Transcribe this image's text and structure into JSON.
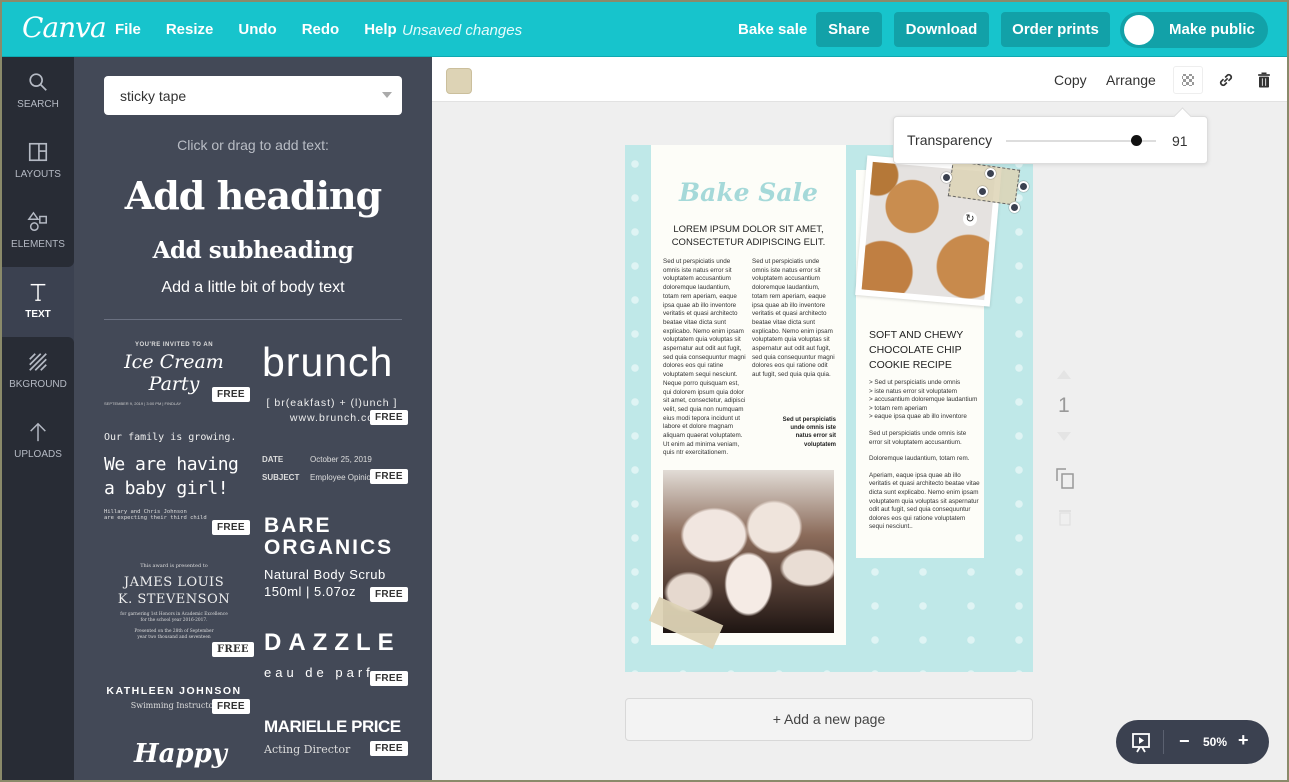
{
  "app": {
    "logo": "Canva",
    "menu": [
      "File",
      "Resize",
      "Undo",
      "Redo",
      "Help"
    ],
    "status": "Unsaved changes",
    "design_title": "Bake sale",
    "share": "Share",
    "download": "Download",
    "order_prints": "Order prints",
    "make_public": "Make public",
    "make_public_on": false,
    "accent": "#17c4cc"
  },
  "rail": [
    {
      "label": "SEARCH",
      "icon": "search-icon"
    },
    {
      "label": "LAYOUTS",
      "icon": "layouts-icon"
    },
    {
      "label": "ELEMENTS",
      "icon": "elements-icon"
    },
    {
      "label": "TEXT",
      "icon": "text-icon",
      "active": true
    },
    {
      "label": "BKGROUND",
      "icon": "background-icon"
    },
    {
      "label": "UPLOADS",
      "icon": "upload-icon"
    }
  ],
  "panel": {
    "search_value": "sticky tape",
    "hint": "Click or drag to add text:",
    "add_heading": "Add heading",
    "add_subheading": "Add subheading",
    "add_body": "Add a little bit of body text",
    "free_badge": "FREE",
    "templates": {
      "ice_cream": {
        "line1": "YOU'RE INVITED TO AN",
        "line2": "Ice Cream Party",
        "line3": "SEPTEMBER 9, 2019 | 3:00 PM | FINDLAY"
      },
      "brunch": {
        "line1": "brunch",
        "line2": "[ br(eakfast) + (l)unch ]",
        "line3": "www.brunch.co"
      },
      "baby": {
        "line1": "Our family is growing.",
        "line2": "We are having",
        "line3": "a baby girl!",
        "line4": "Hillary and Chris Johnson",
        "line5": "are expecting their third child"
      },
      "memo": {
        "date_label": "DATE",
        "date_value": "October 25, 2019",
        "subject_label": "SUBJECT",
        "subject_value": "Employee Opinion"
      },
      "organics": {
        "line1": "BARE",
        "line2": "ORGANICS",
        "line3": "Natural Body Scrub",
        "line4": "150ml | 5.07oz"
      },
      "award": {
        "line1": "This award is presented to",
        "line2": "JAMES LOUIS",
        "line3": "K. STEVENSON",
        "line4": "for garnering 1st Honors in Academic Excellence",
        "line5": "for the school year 2016-2017.",
        "line6": "Presented on the 28th of September",
        "line7": "year two thousand and seventeen"
      },
      "dazzle": {
        "line1": "DAZZLE",
        "line2": "eau de parfum"
      },
      "kathleen": {
        "line1": "KATHLEEN JOHNSON",
        "line2": "Swimming Instructor"
      },
      "marielle": {
        "line1": "MARIELLE PRICE",
        "line2": "Acting Director"
      },
      "happy": {
        "line1": "Happy"
      }
    }
  },
  "toolbar": {
    "copy": "Copy",
    "arrange": "Arrange",
    "swatch_color": "#ddd3b5"
  },
  "transparency": {
    "label": "Transparency",
    "value": 91
  },
  "design": {
    "title": "Bake Sale",
    "headline": "LOREM IPSUM DOLOR SIT AMET, CONSECTETUR ADIPISCING ELIT.",
    "col1": "Sed ut perspiciatis unde omnis iste natus error sit voluptatem accusantium doloremque laudantium, totam rem aperiam, eaque ipsa quae ab illo inventore veritatis et quasi architecto beatae vitae dicta sunt explicabo. Nemo enim ipsam voluptatem quia voluptas sit aspernatur aut odit aut fugit, sed quia consequuntur magni dolores eos qui ratine voluptatem sequi nesciunt. Neque porro quisquam est, qui dolorem ipsum quia dolor sit amet, consectetur, adipisci velit, sed quia non numquam eius modi tepora incidunt ut labore et dolore magnam aliquam quaerat voluptatem. Ut enim ad minima veniam, quis ntr exercitationem.",
    "col2": "Sed ut perspiciatis unde omnis iste natus error sit voluptatem accusantium doloremque laudantium, totam rem aperiam, eaque ipsa quae ab illo inventore veritatis et quasi architecto beatae vitae dicta sunt explicabo. Nemo enim ipsam voluptatem quia voluptas sit aspernatur aut odit aut fugit, sed quia consequuntur magni dolores eos qui ratione odit aut fugit, sed quia quia quia.",
    "col2_note": "Sed ut perspiciatis unde omnis iste natus error sit voluptatem",
    "recipe_title": "SOFT AND CHEWY CHOCOLATE CHIP COOKIE RECIPE",
    "recipe_bullets": [
      "> Sed ut perspiciatis unde omnis",
      "> iste natus error sit voluptatem",
      "> accusantium doloremque laudantium",
      ">  totam rem aperiam",
      "> eaque ipsa quae ab illo inventore"
    ],
    "recipe_p1": "Sed ut perspiciatis unde omnis iste error sit voluptatem accusantium.",
    "recipe_p2": "Doloremque laudantium, totam rem.",
    "recipe_p3": "Aperiam, eaque ipsa quae ab illo veritatis et quasi architecto beatae vitae dicta sunt explicabo. Nemo enim ipsam voluptatem quia voluptas sit aspernatur odit aut fugit, sed quia consequuntur dolores eos qui ratione voluptatem sequi nesciunt.."
  },
  "page_tools": {
    "page_number": "1"
  },
  "add_page": "+ Add a new page",
  "zoom": {
    "level": "50%",
    "minus": "−",
    "plus": "+"
  }
}
